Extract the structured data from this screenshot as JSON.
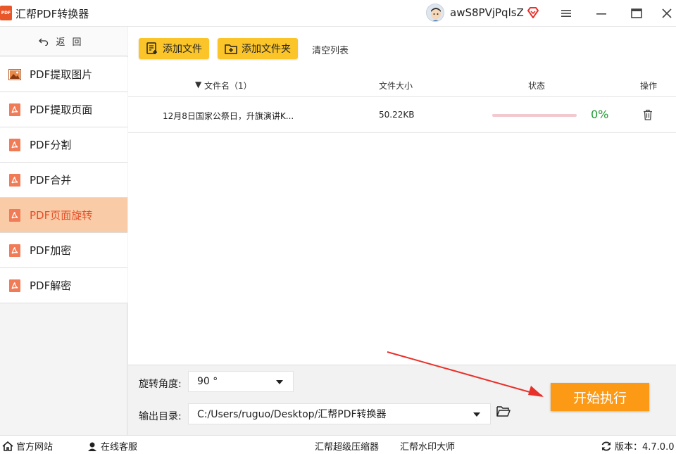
{
  "app": {
    "logo_text": "PDF",
    "title": "汇帮PDF转换器"
  },
  "user": {
    "name": "awS8PVjPqlsZ"
  },
  "colors": {
    "accent": "#fbc52a",
    "active_bg": "#f9cba6",
    "active_text": "#e4502a",
    "start": "#fc9a16",
    "progress_text": "#1e9a34",
    "arrow": "#e8312b"
  },
  "sidebar": {
    "back_label": "返回",
    "items": [
      {
        "label": "PDF提取图片",
        "icon": "image-icon"
      },
      {
        "label": "PDF提取页面",
        "icon": "pdf-icon"
      },
      {
        "label": "PDF分割",
        "icon": "pdf-icon"
      },
      {
        "label": "PDF合并",
        "icon": "pdf-icon"
      },
      {
        "label": "PDF页面旋转",
        "icon": "pdf-icon",
        "active": true
      },
      {
        "label": "PDF加密",
        "icon": "pdf-icon"
      },
      {
        "label": "PDF解密",
        "icon": "pdf-icon"
      }
    ]
  },
  "toolbar": {
    "add_file": "添加文件",
    "add_folder": "添加文件夹",
    "clear": "清空列表"
  },
  "table": {
    "headers": {
      "name": "文件名（1）",
      "size": "文件大小",
      "status": "状态",
      "action": "操作"
    },
    "rows": [
      {
        "name": "12月8日国家公祭日，升旗演讲K...",
        "size": "50.22KB",
        "progress": 0,
        "progress_text": "0%"
      }
    ]
  },
  "settings": {
    "angle_label": "旋转角度:",
    "angle_value": "90 °",
    "output_label": "输出目录:",
    "output_path": "C:/Users/ruguo/Desktop/汇帮PDF转换器",
    "start_label": "开始执行"
  },
  "statusbar": {
    "website": "官方网站",
    "support": "在线客服",
    "compressor": "汇帮超级压缩器",
    "watermark": "汇帮水印大师",
    "version": "版本：4.7.0.0"
  }
}
